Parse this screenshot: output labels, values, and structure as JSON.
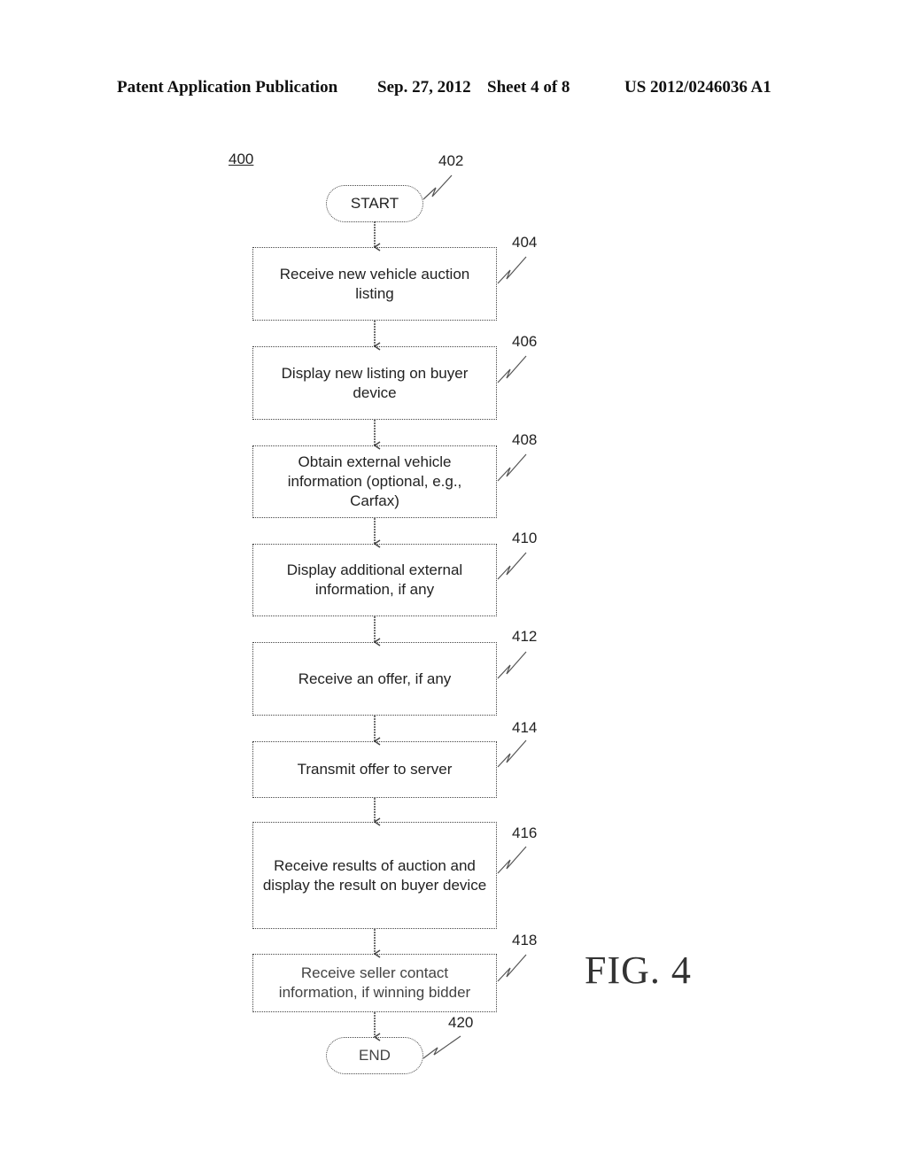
{
  "header": {
    "publication": "Patent Application Publication",
    "date": "Sep. 27, 2012",
    "sheet": "Sheet 4 of 8",
    "number": "US 2012/0246036 A1"
  },
  "figure": {
    "ref": "400",
    "caption": "FIG. 4"
  },
  "start": {
    "label": "START",
    "ref": "402"
  },
  "steps": [
    {
      "ref": "404",
      "text": "Receive new vehicle auction listing"
    },
    {
      "ref": "406",
      "text": "Display new listing on buyer device"
    },
    {
      "ref": "408",
      "text": "Obtain external vehicle information (optional, e.g., Carfax)"
    },
    {
      "ref": "410",
      "text": "Display additional external information, if any"
    },
    {
      "ref": "412",
      "text": "Receive an offer, if any"
    },
    {
      "ref": "414",
      "text": "Transmit offer to server"
    },
    {
      "ref": "416",
      "text": "Receive results of auction and display the result on buyer device"
    },
    {
      "ref": "418",
      "text": "Receive seller contact information, if winning bidder"
    }
  ],
  "end": {
    "label": "END",
    "ref": "420"
  }
}
